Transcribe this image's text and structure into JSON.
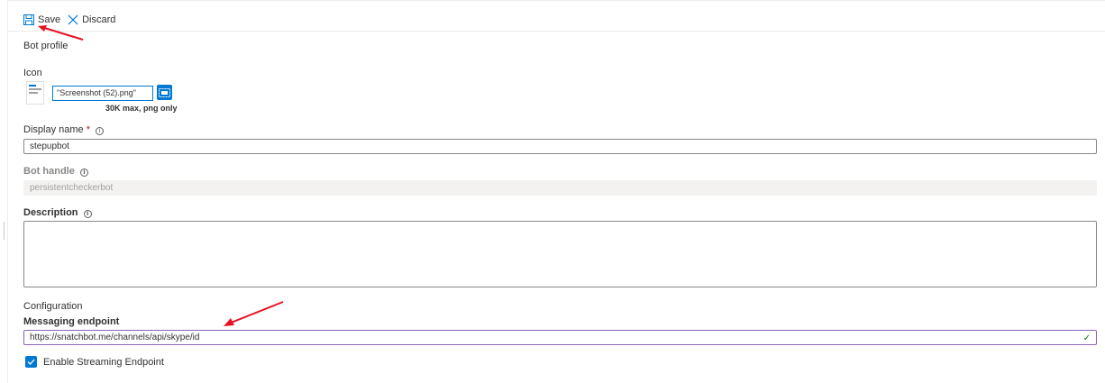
{
  "toolbar": {
    "save_label": "Save",
    "discard_label": "Discard"
  },
  "bot_profile": {
    "title": "Bot profile",
    "icon_label": "Icon",
    "icon_file_value": "\"Screenshot (52).png\"",
    "icon_hint": "30K max, png only"
  },
  "fields": {
    "display_name_label": "Display name",
    "display_name_required": "*",
    "display_name_value": "stepupbot",
    "bot_handle_label": "Bot handle",
    "bot_handle_value": "persistentcheckerbot",
    "description_label": "Description",
    "description_value": ""
  },
  "configuration": {
    "title": "Configuration",
    "endpoint_label": "Messaging endpoint",
    "endpoint_value": "https://snatchbot.me/channels/api/skype/id",
    "streaming_label": "Enable Streaming Endpoint",
    "streaming_checked": true
  },
  "info_glyph": "i",
  "colors": {
    "accent": "#0078d4",
    "required": "#a4262c",
    "annotation_arrow": "#e81123",
    "valid_check": "#107c10"
  }
}
